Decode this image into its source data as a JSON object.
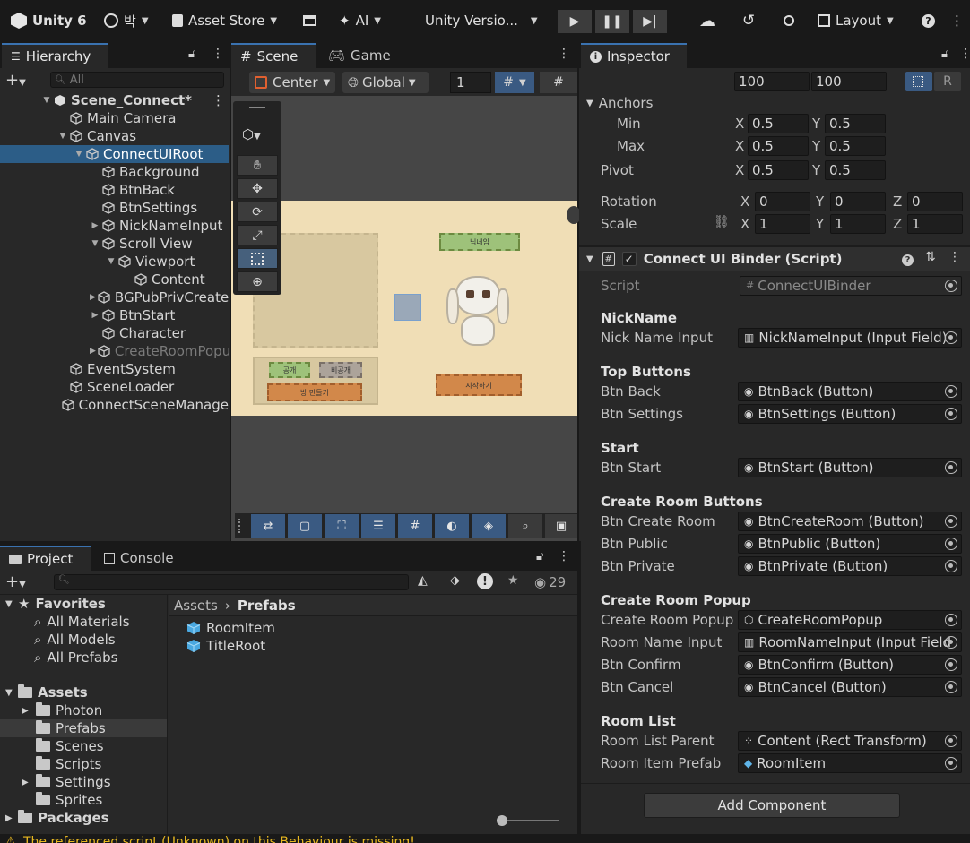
{
  "topbar": {
    "account": "Unity 6",
    "user": "박",
    "asset_store": "Asset Store",
    "ai": "AI",
    "version": "Unity Versio...",
    "layout": "Layout"
  },
  "hierarchy": {
    "tab": "Hierarchy",
    "search_placeholder": "All",
    "items": [
      {
        "label": "Scene_Connect*",
        "depth": 0,
        "arrow": "down",
        "type": "scene"
      },
      {
        "label": "Main Camera",
        "depth": 1,
        "arrow": "",
        "type": "go"
      },
      {
        "label": "Canvas",
        "depth": 1,
        "arrow": "down",
        "type": "go"
      },
      {
        "label": "ConnectUIRoot",
        "depth": 2,
        "arrow": "down",
        "type": "go",
        "selected": true
      },
      {
        "label": "Background",
        "depth": 3,
        "arrow": "",
        "type": "go"
      },
      {
        "label": "BtnBack",
        "depth": 3,
        "arrow": "",
        "type": "go"
      },
      {
        "label": "BtnSettings",
        "depth": 3,
        "arrow": "",
        "type": "go"
      },
      {
        "label": "NickNameInput",
        "depth": 3,
        "arrow": "right",
        "type": "go"
      },
      {
        "label": "Scroll View",
        "depth": 3,
        "arrow": "down",
        "type": "go"
      },
      {
        "label": "Viewport",
        "depth": 4,
        "arrow": "down",
        "type": "go"
      },
      {
        "label": "Content",
        "depth": 5,
        "arrow": "",
        "type": "go"
      },
      {
        "label": "BGPubPrivCreate",
        "depth": 3,
        "arrow": "right",
        "type": "go"
      },
      {
        "label": "BtnStart",
        "depth": 3,
        "arrow": "right",
        "type": "go"
      },
      {
        "label": "Character",
        "depth": 3,
        "arrow": "",
        "type": "go"
      },
      {
        "label": "CreateRoomPopu",
        "depth": 3,
        "arrow": "right",
        "type": "go",
        "dim": true
      },
      {
        "label": "EventSystem",
        "depth": 1,
        "arrow": "",
        "type": "go"
      },
      {
        "label": "SceneLoader",
        "depth": 1,
        "arrow": "",
        "type": "go"
      },
      {
        "label": "ConnectSceneManage",
        "depth": 1,
        "arrow": "",
        "type": "go"
      }
    ]
  },
  "scene": {
    "tab_scene": "Scene",
    "tab_game": "Game",
    "pivot": "Center",
    "space": "Global",
    "snap": "1",
    "canvas_texts": {
      "nick": "닉네임",
      "public": "공개",
      "private": "비공개",
      "create": "방 만들기",
      "start": "시작하기"
    }
  },
  "inspector": {
    "tab": "Inspector",
    "width_val": "100",
    "height_val": "100",
    "anchors": "Anchors",
    "min": "Min",
    "max": "Max",
    "pivot": "Pivot",
    "anchor_min": {
      "x": "0.5",
      "y": "0.5"
    },
    "anchor_max": {
      "x": "0.5",
      "y": "0.5"
    },
    "pivot_val": {
      "x": "0.5",
      "y": "0.5"
    },
    "rotation": "Rotation",
    "rotation_val": {
      "x": "0",
      "y": "0",
      "z": "0"
    },
    "scale": "Scale",
    "scale_val": {
      "x": "1",
      "y": "1",
      "z": "1"
    },
    "component": "Connect UI Binder (Script)",
    "script_label": "Script",
    "script_val": "ConnectUIBinder",
    "sections": [
      {
        "header": "NickName",
        "fields": [
          {
            "label": "Nick Name Input",
            "value": "NickNameInput (Input Field)",
            "icon": "input"
          }
        ]
      },
      {
        "header": "Top Buttons",
        "fields": [
          {
            "label": "Btn Back",
            "value": "BtnBack (Button)",
            "icon": "button"
          },
          {
            "label": "Btn Settings",
            "value": "BtnSettings (Button)",
            "icon": "button"
          }
        ]
      },
      {
        "header": "Start",
        "fields": [
          {
            "label": "Btn Start",
            "value": "BtnStart (Button)",
            "icon": "button"
          }
        ]
      },
      {
        "header": "Create Room Buttons",
        "fields": [
          {
            "label": "Btn Create Room",
            "value": "BtnCreateRoom (Button)",
            "icon": "button"
          },
          {
            "label": "Btn Public",
            "value": "BtnPublic (Button)",
            "icon": "button"
          },
          {
            "label": "Btn Private",
            "value": "BtnPrivate (Button)",
            "icon": "button"
          }
        ]
      },
      {
        "header": "Create Room Popup",
        "fields": [
          {
            "label": "Create Room Popup",
            "value": "CreateRoomPopup",
            "icon": "go"
          },
          {
            "label": "Room Name Input",
            "value": "RoomNameInput (Input Field",
            "icon": "input"
          },
          {
            "label": "Btn Confirm",
            "value": "BtnConfirm (Button)",
            "icon": "button"
          },
          {
            "label": "Btn Cancel",
            "value": "BtnCancel (Button)",
            "icon": "button"
          }
        ]
      },
      {
        "header": "Room List",
        "fields": [
          {
            "label": "Room List Parent",
            "value": "Content (Rect Transform)",
            "icon": "rect"
          },
          {
            "label": "Room Item Prefab",
            "value": "RoomItem",
            "icon": "prefab"
          }
        ]
      }
    ],
    "add_component": "Add Component"
  },
  "project": {
    "tab_project": "Project",
    "tab_console": "Console",
    "count": "29",
    "favorites": "Favorites",
    "fav_items": [
      "All Materials",
      "All Models",
      "All Prefabs"
    ],
    "assets": "Assets",
    "folders": [
      "Photon",
      "Prefabs",
      "Scenes",
      "Scripts",
      "Settings",
      "Sprites"
    ],
    "packages": "Packages",
    "breadcrumb_root": "Assets",
    "breadcrumb_leaf": "Prefabs",
    "files": [
      "RoomItem",
      "TitleRoot"
    ]
  },
  "status": {
    "message": "The referenced script (Unknown) on this Behaviour is missing!"
  }
}
